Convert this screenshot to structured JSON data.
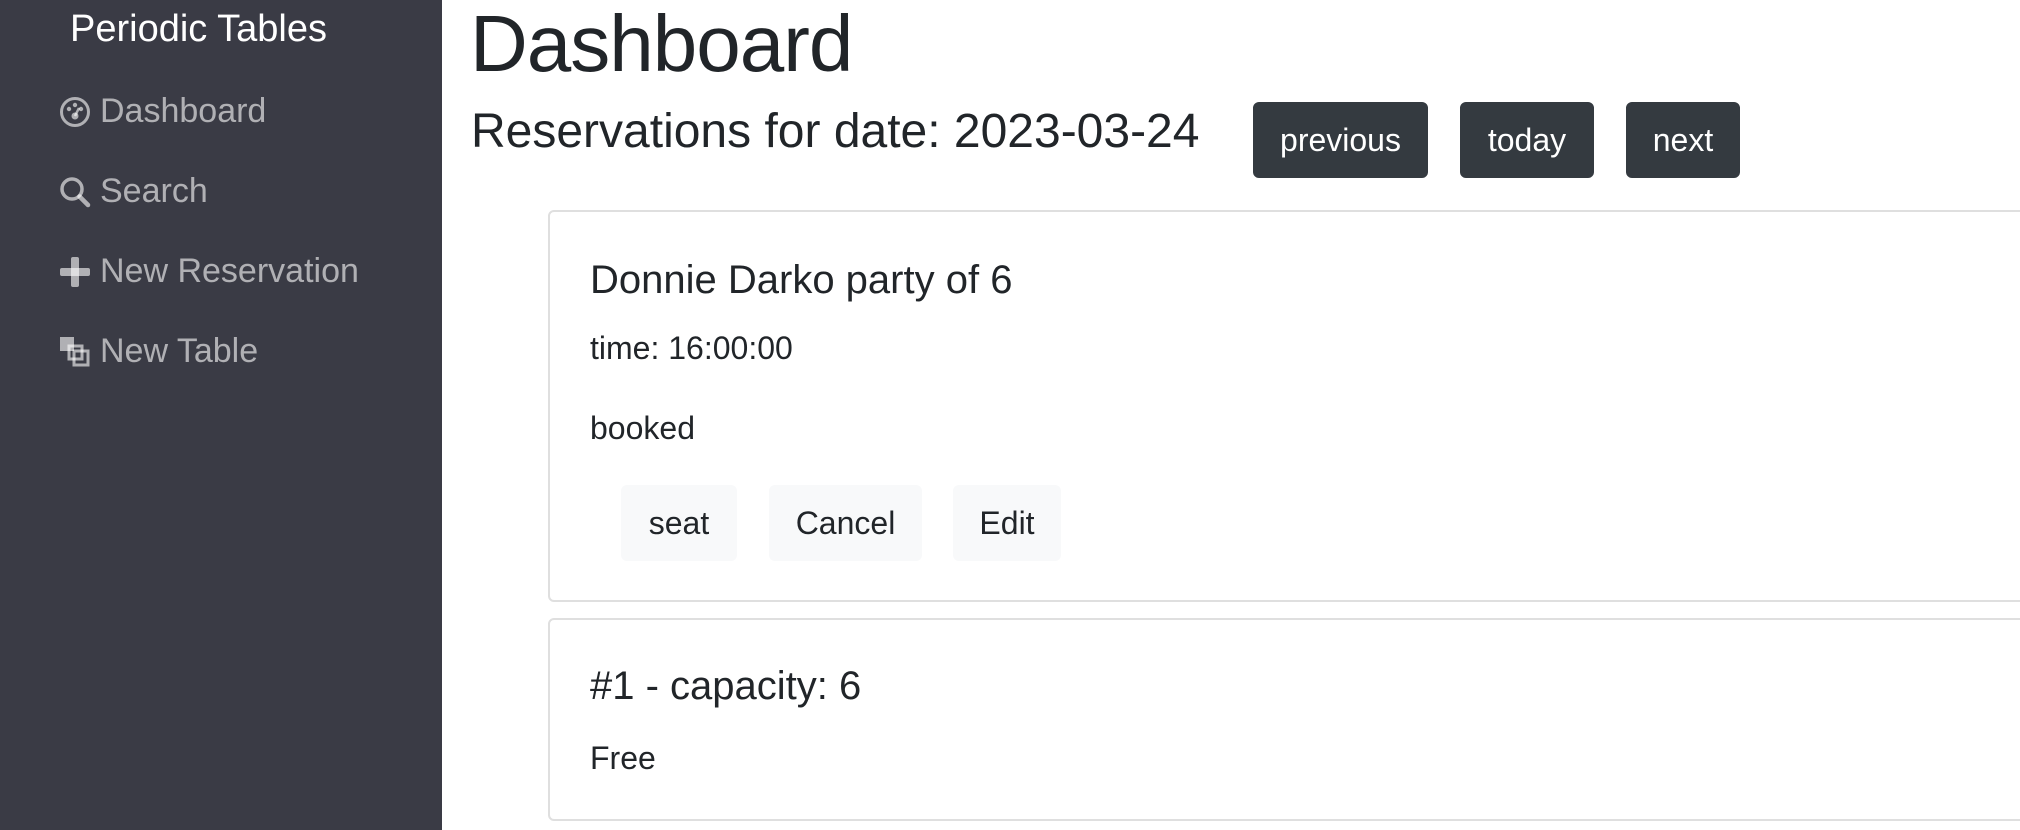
{
  "sidebar": {
    "brand": "Periodic Tables",
    "items": [
      {
        "label": "Dashboard",
        "icon": "dashboard-icon"
      },
      {
        "label": "Search",
        "icon": "search-icon"
      },
      {
        "label": "New Reservation",
        "icon": "plus-icon"
      },
      {
        "label": "New Table",
        "icon": "layers-icon"
      }
    ]
  },
  "main": {
    "title": "Dashboard",
    "reservations_heading": "Reservations for date: 2023-03-24",
    "date_nav": {
      "previous": "previous",
      "today": "today",
      "next": "next"
    },
    "reservations": [
      {
        "title": "Donnie Darko party of 6",
        "time": "time: 16:00:00",
        "status": "booked",
        "actions": {
          "seat": "seat",
          "cancel": "Cancel",
          "edit": "Edit"
        }
      }
    ],
    "tables": [
      {
        "title": "#1 - capacity: 6",
        "status": "Free"
      }
    ]
  },
  "colors": {
    "sidebar_bg": "#3a3b45",
    "dark_button": "#343a40",
    "light_button": "#f8f9fa"
  }
}
